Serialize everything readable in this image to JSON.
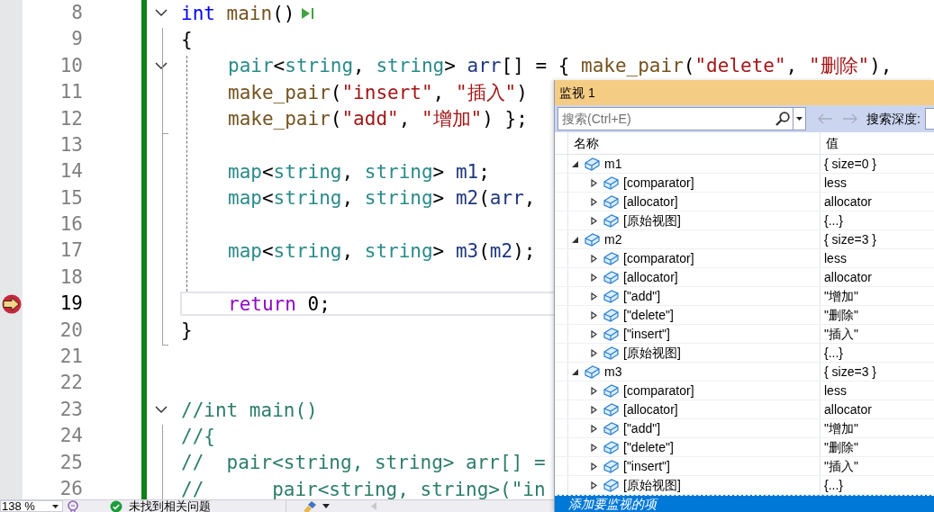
{
  "editor": {
    "lines": [
      {
        "number": "8",
        "fold": true,
        "run_button": true,
        "tokens": [
          {
            "kind": "kw",
            "text": "int"
          },
          {
            "kind": "fn",
            "text": " main"
          },
          {
            "kind": "p",
            "text": "()"
          }
        ]
      },
      {
        "number": "9",
        "tokens": [
          {
            "kind": "p",
            "text": "{"
          }
        ]
      },
      {
        "number": "10",
        "fold": true,
        "indented": true,
        "tokens": [
          {
            "kind": "ty",
            "text": "pair"
          },
          {
            "kind": "p",
            "text": "<"
          },
          {
            "kind": "ty",
            "text": "string"
          },
          {
            "kind": "p",
            "text": ", "
          },
          {
            "kind": "ty",
            "text": "string"
          },
          {
            "kind": "p",
            "text": "> "
          },
          {
            "kind": "var",
            "text": "arr"
          },
          {
            "kind": "p",
            "text": "[] = { "
          },
          {
            "kind": "fn",
            "text": "make_pair"
          },
          {
            "kind": "p",
            "text": "("
          },
          {
            "kind": "str",
            "text": "\"delete\""
          },
          {
            "kind": "p",
            "text": ", "
          },
          {
            "kind": "str",
            "text": "\"删除\""
          },
          {
            "kind": "p",
            "text": "),"
          }
        ]
      },
      {
        "number": "11",
        "indented": true,
        "tokens": [
          {
            "kind": "fn",
            "text": "make_pair"
          },
          {
            "kind": "p",
            "text": "("
          },
          {
            "kind": "str",
            "text": "\"insert\""
          },
          {
            "kind": "p",
            "text": ", "
          },
          {
            "kind": "str",
            "text": "\"插入\""
          },
          {
            "kind": "p",
            "text": ")"
          }
        ]
      },
      {
        "number": "12",
        "indented": true,
        "tokens": [
          {
            "kind": "fn",
            "text": "make_pair"
          },
          {
            "kind": "p",
            "text": "("
          },
          {
            "kind": "str",
            "text": "\"add\""
          },
          {
            "kind": "p",
            "text": ", "
          },
          {
            "kind": "str",
            "text": "\"增加\""
          },
          {
            "kind": "p",
            "text": ") };"
          }
        ]
      },
      {
        "number": "13"
      },
      {
        "number": "14",
        "indented": true,
        "tokens": [
          {
            "kind": "ty",
            "text": "map"
          },
          {
            "kind": "p",
            "text": "<"
          },
          {
            "kind": "ty",
            "text": "string"
          },
          {
            "kind": "p",
            "text": ", "
          },
          {
            "kind": "ty",
            "text": "string"
          },
          {
            "kind": "p",
            "text": "> "
          },
          {
            "kind": "var",
            "text": "m1"
          },
          {
            "kind": "p",
            "text": ";"
          }
        ]
      },
      {
        "number": "15",
        "indented": true,
        "tokens": [
          {
            "kind": "ty",
            "text": "map"
          },
          {
            "kind": "p",
            "text": "<"
          },
          {
            "kind": "ty",
            "text": "string"
          },
          {
            "kind": "p",
            "text": ", "
          },
          {
            "kind": "ty",
            "text": "string"
          },
          {
            "kind": "p",
            "text": "> "
          },
          {
            "kind": "var",
            "text": "m2"
          },
          {
            "kind": "p",
            "text": "("
          },
          {
            "kind": "var",
            "text": "arr"
          },
          {
            "kind": "p",
            "text": ","
          }
        ]
      },
      {
        "number": "16"
      },
      {
        "number": "17",
        "indented": true,
        "tokens": [
          {
            "kind": "ty",
            "text": "map"
          },
          {
            "kind": "p",
            "text": "<"
          },
          {
            "kind": "ty",
            "text": "string"
          },
          {
            "kind": "p",
            "text": ", "
          },
          {
            "kind": "ty",
            "text": "string"
          },
          {
            "kind": "p",
            "text": "> "
          },
          {
            "kind": "var",
            "text": "m3"
          },
          {
            "kind": "p",
            "text": "("
          },
          {
            "kind": "var",
            "text": "m2"
          },
          {
            "kind": "p",
            "text": ");"
          }
        ]
      },
      {
        "number": "18"
      },
      {
        "number": "19",
        "current": true,
        "indented": true,
        "tokens": [
          {
            "kind": "ctl",
            "text": "return"
          },
          {
            "kind": "p",
            "text": " 0;"
          }
        ]
      },
      {
        "number": "20",
        "tokens": [
          {
            "kind": "p",
            "text": "}"
          }
        ]
      },
      {
        "number": "21"
      },
      {
        "number": "22"
      },
      {
        "number": "23",
        "fold": true,
        "tokens": [
          {
            "kind": "cm",
            "text": "//int main()"
          }
        ]
      },
      {
        "number": "24",
        "tokens": [
          {
            "kind": "cm",
            "text": "//{"
          }
        ]
      },
      {
        "number": "25",
        "tokens": [
          {
            "kind": "cm",
            "text": "//  pair<string, string> arr[] ="
          }
        ]
      },
      {
        "number": "26",
        "tokens": [
          {
            "kind": "cm",
            "text": "//      pair<string, string>(\"in"
          }
        ]
      }
    ]
  },
  "watch": {
    "title": "监视 1",
    "search": {
      "placeholder": "搜索(Ctrl+E)"
    },
    "search_depth_label": "搜索深度:",
    "columns": [
      "名称",
      "值"
    ],
    "items": [
      {
        "name": "m1",
        "value": "{ size=0 }",
        "expanded": true,
        "children": [
          {
            "name": "[comparator]",
            "value": "less",
            "expanded": false
          },
          {
            "name": "[allocator]",
            "value": "allocator",
            "expanded": false
          },
          {
            "name": "[原始视图]",
            "value": "{...}",
            "expanded": false
          }
        ]
      },
      {
        "name": "m2",
        "value": "{ size=3 }",
        "expanded": true,
        "children": [
          {
            "name": "[comparator]",
            "value": "less",
            "expanded": false
          },
          {
            "name": "[allocator]",
            "value": "allocator",
            "expanded": false
          },
          {
            "name": "[\"add\"]",
            "value": "\"增加\"",
            "expanded": false
          },
          {
            "name": "[\"delete\"]",
            "value": "\"删除\"",
            "expanded": false
          },
          {
            "name": "[\"insert\"]",
            "value": "\"插入\"",
            "expanded": false
          },
          {
            "name": "[原始视图]",
            "value": "{...}",
            "expanded": false
          }
        ]
      },
      {
        "name": "m3",
        "value": "{ size=3 }",
        "expanded": true,
        "children": [
          {
            "name": "[comparator]",
            "value": "less",
            "expanded": false
          },
          {
            "name": "[allocator]",
            "value": "allocator",
            "expanded": false
          },
          {
            "name": "[\"add\"]",
            "value": "\"增加\"",
            "expanded": false
          },
          {
            "name": "[\"delete\"]",
            "value": "\"删除\"",
            "expanded": false
          },
          {
            "name": "[\"insert\"]",
            "value": "\"插入\"",
            "expanded": false
          },
          {
            "name": "[原始视图]",
            "value": "{...}",
            "expanded": false
          }
        ]
      }
    ],
    "add_item_placeholder": "添加要监视的项"
  },
  "status_bar": {
    "zoom": "138 %",
    "issues": "未找到相关问题"
  }
}
